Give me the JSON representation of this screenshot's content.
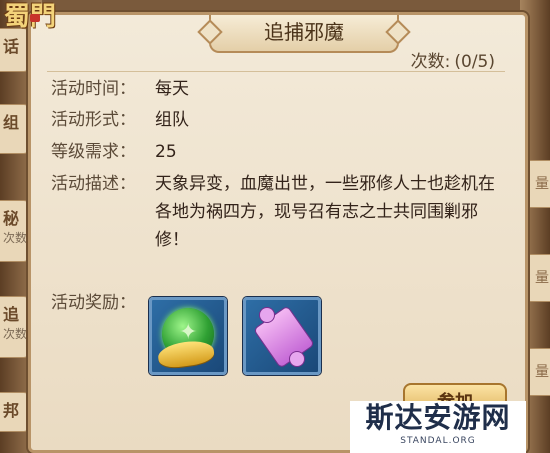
{
  "background": {
    "logo_text": "蜀門",
    "left_tabs": [
      {
        "label": "话",
        "sub": ""
      },
      {
        "label": "组",
        "sub": ""
      },
      {
        "label": "秘",
        "sub": "次数"
      },
      {
        "label": "追",
        "sub": "次数"
      },
      {
        "label": "邦",
        "sub": ""
      }
    ],
    "right_tabs": [
      "量",
      "量",
      "量"
    ]
  },
  "dialog": {
    "title": "追捕邪魔",
    "count_label": "次数:",
    "count_value": "(0/5)",
    "rows": [
      {
        "key": "活动时间：",
        "value": "每天"
      },
      {
        "key": "活动形式：",
        "value": "组队"
      },
      {
        "key": "等级需求：",
        "value": "25"
      },
      {
        "key": "活动描述：",
        "value": "天象异变，血魔出世，一些邪修人士也趁机在各地为祸四方，现号召有志之士共同围剿邪修！"
      }
    ],
    "reward_label": "活动奖励：",
    "rewards": [
      {
        "icon": "green-orb-gold-ingot-icon"
      },
      {
        "icon": "purple-scroll-icon"
      }
    ],
    "join_button": "参加"
  },
  "watermark": {
    "main": "斯达安游网",
    "sub": "STANDAL.ORG"
  },
  "colors": {
    "dialog_bg": "#f3ead9",
    "border": "#b89468",
    "reward_slot": "#2e6ea6"
  }
}
